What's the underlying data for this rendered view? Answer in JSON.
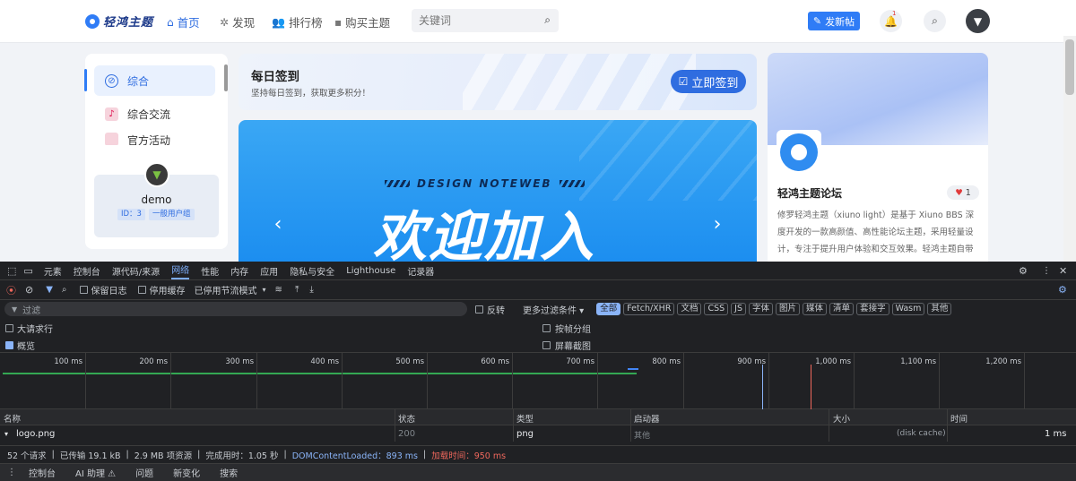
{
  "nav": {
    "logo_text": "轻鸿主题",
    "items": [
      {
        "label": "首页",
        "icon": "home-icon"
      },
      {
        "label": "发现",
        "icon": "compass-icon"
      },
      {
        "label": "排行榜",
        "icon": "users-icon"
      },
      {
        "label": "购买主题",
        "icon": "bag-icon"
      }
    ],
    "search_placeholder": "关键词",
    "post_button": "发新帖",
    "notify_badge": "1"
  },
  "sidebar": {
    "items": [
      {
        "label": "综合"
      },
      {
        "label": "综合交流"
      },
      {
        "label": "官方活动"
      }
    ],
    "user": {
      "name": "demo",
      "id_badge": "ID：3",
      "group_badge": "一般用户组"
    }
  },
  "signin": {
    "title": "每日签到",
    "subtitle": "坚持每日签到，获取更多积分！",
    "button": "立即签到"
  },
  "banner": {
    "tag": "DESIGN NOTEWEB",
    "headline": "欢迎加入"
  },
  "forum": {
    "title": "轻鸿主题论坛",
    "likes": "1",
    "desc": "修罗轻鸿主题（xiuno light）是基于 Xiuno BBS 深度开发的一款高颜值、高性能论坛主题，采用轻量设计，专注于提升用户体验和交互效果。轻鸿主题自带"
  },
  "devtools": {
    "tabs": [
      "元素",
      "控制台",
      "源代码/来源",
      "网络",
      "性能",
      "内存",
      "应用",
      "隐私与安全",
      "Lighthouse",
      "记录器"
    ],
    "active_tab": "网络",
    "toolbar": {
      "preserve_log": "保留日志",
      "disable_cache": "停用缓存",
      "throttle": "已停用节流模式"
    },
    "filter": {
      "placeholder": "过滤",
      "invert": "反转",
      "more": "更多过滤条件 ▾",
      "chips": [
        "全部",
        "Fetch/XHR",
        "文档",
        "CSS",
        "JS",
        "字体",
        "图片",
        "媒体",
        "清单",
        "套接字",
        "Wasm",
        "其他"
      ]
    },
    "options": {
      "big_rows": "大请求行",
      "overview": "概览",
      "group_by_frame": "按帧分组",
      "screenshots": "屏幕截图"
    },
    "timeline_ticks": [
      "100 ms",
      "200 ms",
      "300 ms",
      "400 ms",
      "500 ms",
      "600 ms",
      "700 ms",
      "800 ms",
      "900 ms",
      "1,000 ms",
      "1,100 ms",
      "1,200 ms"
    ],
    "columns": [
      "名称",
      "状态",
      "类型",
      "启动器",
      "大小",
      "时间"
    ],
    "rows": [
      {
        "name": "logo.png",
        "status": "200",
        "type": "png",
        "initiator": "其他",
        "size": "(disk cache)",
        "time": "1 ms"
      }
    ],
    "status_bar": {
      "requests": "52 个请求",
      "transferred": "已传输 19.1 kB",
      "resources": "2.9 MB 项资源",
      "finish": "完成用时：1.05 秒",
      "dcl": "DOMContentLoaded：893 ms",
      "load": "加载时间：950 ms"
    },
    "drawer_tabs": [
      "控制台",
      "AI 助理 ⚠",
      "问题",
      "新变化",
      "搜索"
    ]
  }
}
